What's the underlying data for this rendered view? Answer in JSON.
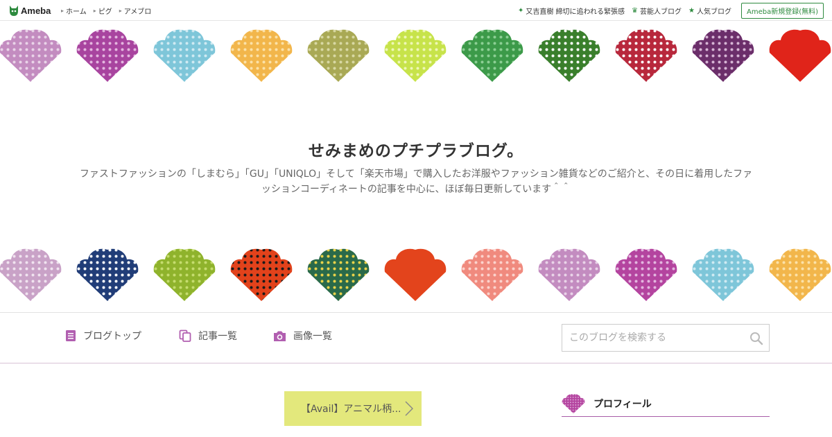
{
  "topbar": {
    "logo_text": "Ameba",
    "nav": [
      {
        "label": "ホーム"
      },
      {
        "label": "ピグ"
      },
      {
        "label": "アメブロ"
      }
    ],
    "right_links": [
      {
        "label": "又吉直樹 締切に追われる緊張感",
        "icon": "sparkle-icon"
      },
      {
        "label": "芸能人ブログ",
        "icon": "crown-icon"
      },
      {
        "label": "人気ブログ",
        "icon": "star-icon"
      }
    ],
    "register_label": "Ameba新規登録(無料)"
  },
  "header": {
    "title": "せみまめのプチプラブログ。",
    "description": "ファストファッションの「しまむら」「GU」「UNIQLO」そして「楽天市場」で購入したお洋服やファッション雑貨などのご紹介と、その日に着用したファッションコーディネートの記事を中心に、ほぼ毎日更新しています＾＾"
  },
  "patterns": {
    "row1": [
      {
        "fill": "#c38cc0",
        "dot": "#e9d3e8"
      },
      {
        "fill": "#a8449f",
        "dot": "#e3b6df"
      },
      {
        "fill": "#7ec6d9",
        "dot": "#cfeaf2"
      },
      {
        "fill": "#f2b64b",
        "dot": "#fbe1a8"
      },
      {
        "fill": "#a9a955",
        "dot": "#d8d8a3"
      },
      {
        "fill": "#c7e34a",
        "dot": "#eef7b5"
      },
      {
        "fill": "#3c9a49",
        "dot": "#8ccf94"
      },
      {
        "fill": "#3a7f2c",
        "dot": "#ffffff"
      },
      {
        "fill": "#b8283c",
        "dot": "#ffffff"
      },
      {
        "fill": "#6b2e6a",
        "dot": "#d6b5d5"
      },
      {
        "fill": "#e0241a",
        "dot": "#e0241a"
      }
    ],
    "row2": [
      {
        "fill": "#c9a2c7",
        "dot": "#f0e3ef"
      },
      {
        "fill": "#213d78",
        "dot": "#ffffff"
      },
      {
        "fill": "#8fb32c",
        "dot": "#c5dc6e"
      },
      {
        "fill": "#e2421b",
        "dot": "#1a1a1a"
      },
      {
        "fill": "#2a6a4a",
        "dot": "#e9d24a"
      },
      {
        "fill": "#e3441c",
        "dot": "#e3441c"
      },
      {
        "fill": "#f08a7e",
        "dot": "#fbd2cc"
      },
      {
        "fill": "#c38cc0",
        "dot": "#e9d3e8"
      },
      {
        "fill": "#b4449f",
        "dot": "#e3b6df"
      },
      {
        "fill": "#7ec6d9",
        "dot": "#cfeaf2"
      },
      {
        "fill": "#f2b64b",
        "dot": "#fbe1a8"
      }
    ]
  },
  "blog_nav": {
    "items": [
      {
        "label": "ブログトップ",
        "icon": "document-icon"
      },
      {
        "label": "記事一覧",
        "icon": "copy-icon"
      },
      {
        "label": "画像一覧",
        "icon": "camera-icon"
      }
    ],
    "search_placeholder": "このブログを検索する"
  },
  "article_pill": {
    "label": "【Avail】アニマル柄..."
  },
  "profile": {
    "title": "プロフィール"
  },
  "colors": {
    "brand_green": "#2d8a3e",
    "accent_purple": "#b15fb0",
    "pill_yellow": "#e3e87c"
  }
}
